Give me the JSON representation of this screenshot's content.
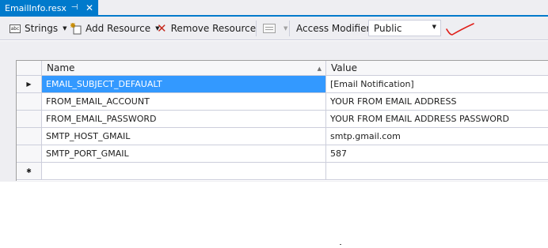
{
  "tab": {
    "title": "EmailInfo.resx",
    "pin_glyph": "⊣",
    "close_glyph": "✕"
  },
  "toolbar": {
    "strings_label": "Strings",
    "strings_icon_text": "abc",
    "add_resource_label": "Add Resource",
    "remove_resource_label": "Remove Resource",
    "access_modifier_label": "Access Modifier:",
    "access_modifier_value": "Public",
    "caret": "▼"
  },
  "grid": {
    "columns": [
      {
        "label": "Name"
      },
      {
        "label": "Value"
      }
    ],
    "sort_glyph": "▲",
    "current_row_glyph": "▶",
    "new_row_glyph": "✱",
    "rows": [
      {
        "name": "EMAIL_SUBJECT_DEFAUALT",
        "value": "[Email Notification]"
      },
      {
        "name": "FROM_EMAIL_ACCOUNT",
        "value": "YOUR FROM EMAIL ADDRESS"
      },
      {
        "name": "FROM_EMAIL_PASSWORD",
        "value": "YOUR FROM EMAIL ADDRESS PASSWORD"
      },
      {
        "name": "SMTP_HOST_GMAIL",
        "value": "smtp.gmail.com"
      },
      {
        "name": "SMTP_PORT_GMAIL",
        "value": "587"
      }
    ]
  },
  "colors": {
    "accent": "#007acc",
    "selection": "#3399ff",
    "annotation": "#e0201a",
    "remove_icon": "#c5281c"
  }
}
